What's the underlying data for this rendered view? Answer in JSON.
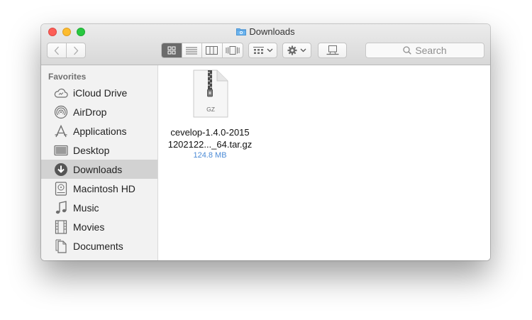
{
  "window": {
    "title": "Downloads"
  },
  "toolbar": {
    "search_placeholder": "Search"
  },
  "sidebar": {
    "heading": "Favorites",
    "items": [
      {
        "label": "iCloud Drive",
        "icon": "cloud-icon"
      },
      {
        "label": "AirDrop",
        "icon": "airdrop-icon"
      },
      {
        "label": "Applications",
        "icon": "applications-icon"
      },
      {
        "label": "Desktop",
        "icon": "desktop-icon"
      },
      {
        "label": "Downloads",
        "icon": "downloads-icon",
        "selected": true
      },
      {
        "label": "Macintosh HD",
        "icon": "hard-drive-icon"
      },
      {
        "label": "Music",
        "icon": "music-note-icon"
      },
      {
        "label": "Movies",
        "icon": "film-icon"
      },
      {
        "label": "Documents",
        "icon": "documents-icon"
      }
    ]
  },
  "files": [
    {
      "name_line1": "cevelop-1.4.0-2015",
      "name_line2": "1202122..._64.tar.gz",
      "size": "124.8 MB",
      "icon_badge": "GZ",
      "icon": "zip-archive-icon"
    }
  ],
  "colors": {
    "selection": "#d2d2d2",
    "size_text": "#4c8bd6",
    "close": "#fc5f57",
    "minimize": "#fdbc2e",
    "zoom": "#28c840"
  }
}
